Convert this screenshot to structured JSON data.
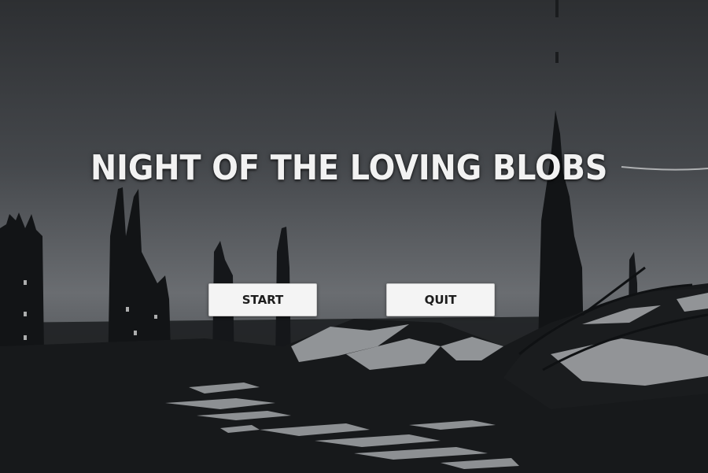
{
  "game": {
    "title": "NIGHT OF THE LOVING BLOBS"
  },
  "menu": {
    "start_label": "START",
    "quit_label": "QUIT"
  },
  "colors": {
    "sky_top": "#2f3134",
    "sky_horizon": "#6b6e72",
    "silhouette": "#121416",
    "highlight": "#a8abae",
    "button_bg": "#f4f4f4",
    "title_text": "#f2f2f2"
  }
}
